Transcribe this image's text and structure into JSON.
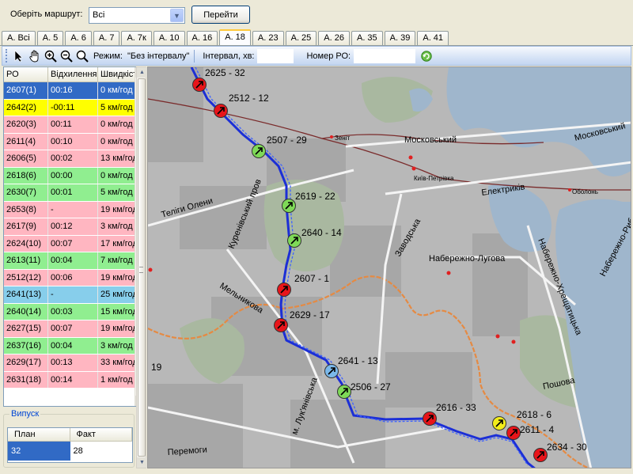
{
  "route_bar": {
    "label": "Оберіть маршрут:",
    "selected": "Всі",
    "go_button": "Перейти"
  },
  "tabs": [
    "А. Всі",
    "А. 5",
    "А. 6",
    "А. 7",
    "А. 7к",
    "А. 10",
    "А. 16",
    "А. 18",
    "А. 23",
    "А. 25",
    "А. 26",
    "А. 35",
    "А. 39",
    "А. 41"
  ],
  "active_tab": "А. 18",
  "toolbar": {
    "mode_label": "Режим:",
    "mode_value": "\"Без інтервалу\"",
    "interval_label": "Інтервал, хв:",
    "interval_value": "",
    "ro_label": "Номер РО:",
    "ro_value": ""
  },
  "grid": {
    "headers": [
      "РО",
      "Відхилення",
      "Швидкість"
    ],
    "rows": [
      {
        "ro": "2607(1)",
        "dev": "00:16",
        "speed": "0 км/год",
        "state": "selected"
      },
      {
        "ro": "2642(2)",
        "dev": "-00:11",
        "speed": "5 км/год",
        "state": "yellow"
      },
      {
        "ro": "2620(3)",
        "dev": "00:11",
        "speed": "0 км/год",
        "state": "red"
      },
      {
        "ro": "2611(4)",
        "dev": "00:10",
        "speed": "0 км/год",
        "state": "red"
      },
      {
        "ro": "2606(5)",
        "dev": "00:02",
        "speed": "13 км/год",
        "state": "red"
      },
      {
        "ro": "2618(6)",
        "dev": "00:00",
        "speed": "0 км/год",
        "state": "green"
      },
      {
        "ro": "2630(7)",
        "dev": "00:01",
        "speed": "5 км/год",
        "state": "green"
      },
      {
        "ro": "2653(8)",
        "dev": "-",
        "speed": "19 км/год",
        "state": "red"
      },
      {
        "ro": "2617(9)",
        "dev": "00:12",
        "speed": "3 км/год",
        "state": "red"
      },
      {
        "ro": "2624(10)",
        "dev": "00:07",
        "speed": "17 км/год",
        "state": "red"
      },
      {
        "ro": "2613(11)",
        "dev": "00:04",
        "speed": "7 км/год",
        "state": "green"
      },
      {
        "ro": "2512(12)",
        "dev": "00:06",
        "speed": "19 км/год",
        "state": "red"
      },
      {
        "ro": "2641(13)",
        "dev": "-",
        "speed": "25 км/год",
        "state": "blue"
      },
      {
        "ro": "2640(14)",
        "dev": "00:03",
        "speed": "15 км/год",
        "state": "green"
      },
      {
        "ro": "2627(15)",
        "dev": "00:07",
        "speed": "19 км/год",
        "state": "red"
      },
      {
        "ro": "2637(16)",
        "dev": "00:04",
        "speed": "3 км/год",
        "state": "green"
      },
      {
        "ro": "2629(17)",
        "dev": "00:13",
        "speed": "33 км/год",
        "state": "red"
      },
      {
        "ro": "2631(18)",
        "dev": "00:14",
        "speed": "1 км/год",
        "state": "red"
      }
    ]
  },
  "row_colors": {
    "selected": "#316ac5",
    "yellow": "#ffff00",
    "red": "#ffb6c1",
    "green": "#90ee90",
    "blue": "#87ceeb"
  },
  "output": {
    "title": "Випуск",
    "plan_label": "План",
    "fact_label": "Факт",
    "plan_value": "32",
    "fact_value": "28"
  },
  "map": {
    "streets": [
      {
        "name": "Московський"
      },
      {
        "name": "Московський"
      },
      {
        "name": "Електриків"
      },
      {
        "name": "Набережно-Лугова"
      },
      {
        "name": "Заводська"
      },
      {
        "name": "Набережно-Хрещатицька"
      },
      {
        "name": "Набережно-Рибальська"
      },
      {
        "name": "Куренівський пров"
      },
      {
        "name": "Теліги Олени"
      },
      {
        "name": "Мельникова"
      },
      {
        "name": "м. Лук'янівська"
      },
      {
        "name": "Перемоги"
      },
      {
        "name": "Пошова"
      },
      {
        "name": "Зеніт"
      },
      {
        "name": "Київ-Петрівка"
      },
      {
        "name": "Оболонь"
      },
      {
        "name": "19"
      }
    ],
    "vehicles": [
      {
        "label": "2625 - 32",
        "color": "red"
      },
      {
        "label": "2512 - 12",
        "color": "red"
      },
      {
        "label": "2507 - 29",
        "color": "green"
      },
      {
        "label": "2619 - 22",
        "color": "green"
      },
      {
        "label": "2640 - 14",
        "color": "green"
      },
      {
        "label": "2607 - 1",
        "color": "red"
      },
      {
        "label": "2629 - 17",
        "color": "red"
      },
      {
        "label": "2641 - 13",
        "color": "blue"
      },
      {
        "label": "2506 - 27",
        "color": "green"
      },
      {
        "label": "2616 - 33",
        "color": "red"
      },
      {
        "label": "2618 - 6",
        "color": "yellow"
      },
      {
        "label": "2611 - 4",
        "color": "red"
      },
      {
        "label": "2634 - 30",
        "color": "red"
      }
    ]
  }
}
